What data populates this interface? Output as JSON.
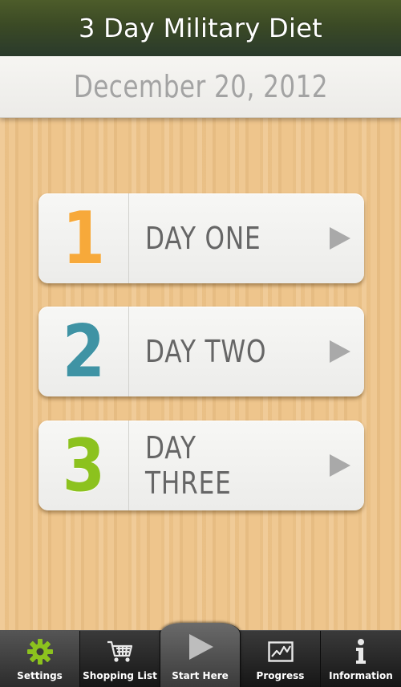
{
  "header": {
    "title": "3 Day Military Diet"
  },
  "date_bar": {
    "date": "December 20, 2012"
  },
  "days": [
    {
      "number": "1",
      "label": "DAY ONE",
      "color": "#f7a93a"
    },
    {
      "number": "2",
      "label": "DAY TWO",
      "color": "#3f93a4"
    },
    {
      "number": "3",
      "label": "DAY THREE",
      "color": "#8cc21e"
    }
  ],
  "tabs": [
    {
      "label": "Settings",
      "icon": "gear-icon",
      "icon_color": "#8cc21e",
      "selected": true
    },
    {
      "label": "Shopping List",
      "icon": "shopping-cart-icon"
    },
    {
      "label": "Start Here",
      "icon": "play-icon"
    },
    {
      "label": "Progress",
      "icon": "chart-icon"
    },
    {
      "label": "Information",
      "icon": "info-icon"
    }
  ]
}
